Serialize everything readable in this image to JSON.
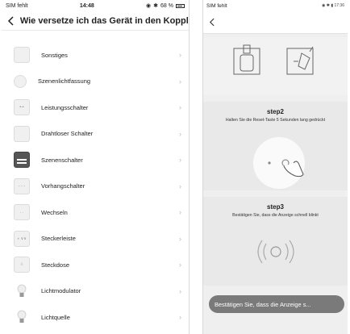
{
  "left": {
    "status": {
      "carrier": "SIM fehlt",
      "time": "14:48",
      "battery": "68 %"
    },
    "title": "Wie versetze ich das Gerät in den Kopplun...",
    "items": [
      {
        "label": "Sonstiges",
        "icon": "device-icon"
      },
      {
        "label": "Szenenlichtfassung",
        "icon": "lamp-socket-icon"
      },
      {
        "label": "Leistungsschalter",
        "icon": "breaker-icon"
      },
      {
        "label": "Drahtloser Schalter",
        "icon": "wireless-switch-icon"
      },
      {
        "label": "Szenenschalter",
        "icon": "scene-switch-icon"
      },
      {
        "label": "Vorhangschalter",
        "icon": "curtain-switch-icon"
      },
      {
        "label": "Wechseln",
        "icon": "switch-icon"
      },
      {
        "label": "Steckerleiste",
        "icon": "power-strip-icon"
      },
      {
        "label": "Steckdose",
        "icon": "socket-icon"
      },
      {
        "label": "Lichtmodulator",
        "icon": "bulb-icon"
      },
      {
        "label": "Lichtquelle",
        "icon": "bulb-icon"
      }
    ]
  },
  "right": {
    "status": {
      "carrier": "SIM fehlt",
      "time": "17:36"
    },
    "step2": {
      "title": "step2",
      "desc": "Halten Sie die Reset-Taste 5 Sekunden lang gedrückt"
    },
    "step3": {
      "title": "step3",
      "desc": "Bestätigen Sie, dass die Anzeige schnell blinkt"
    },
    "toast": "Bestätigen Sie, dass die Anzeige s..."
  }
}
